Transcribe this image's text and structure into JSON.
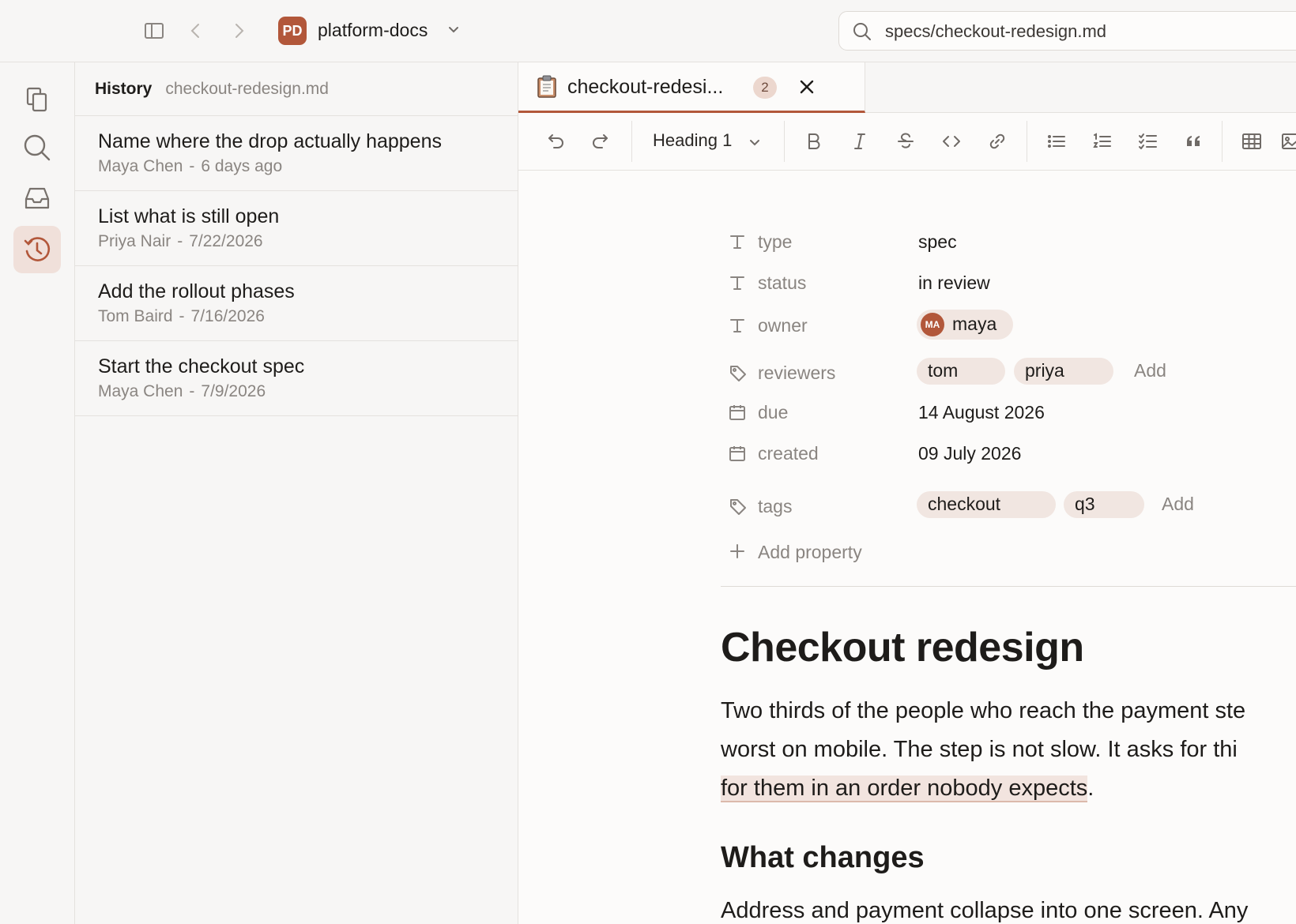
{
  "workspace": {
    "initials": "PD",
    "name": "platform-docs"
  },
  "search": {
    "value": "specs/checkout-redesign.md"
  },
  "history": {
    "title": "History",
    "file": "checkout-redesign.md",
    "commits": [
      {
        "message": "Name where the drop actually happens",
        "author": "Maya Chen",
        "date": "6 days ago"
      },
      {
        "message": "List what is still open",
        "author": "Priya Nair",
        "date": "7/22/2026"
      },
      {
        "message": "Add the rollout phases",
        "author": "Tom Baird",
        "date": "7/16/2026"
      },
      {
        "message": "Start the checkout spec",
        "author": "Maya Chen",
        "date": "7/9/2026"
      }
    ],
    "separator": "-"
  },
  "tab": {
    "label": "checkout-redesi...",
    "badge": "2"
  },
  "toolbar": {
    "block_type": "Heading 1"
  },
  "properties": {
    "type": {
      "key": "type",
      "value": "spec"
    },
    "status": {
      "key": "status",
      "value": "in review"
    },
    "owner": {
      "key": "owner",
      "initials": "MA",
      "name": "maya"
    },
    "reviewers": {
      "key": "reviewers",
      "values": [
        "tom",
        "priya"
      ],
      "add_label": "Add"
    },
    "due": {
      "key": "due",
      "value": "14 August 2026"
    },
    "created": {
      "key": "created",
      "value": "09 July 2026"
    },
    "tags": {
      "key": "tags",
      "values": [
        "checkout",
        "q3"
      ],
      "add_label": "Add"
    },
    "add_property_label": "Add property"
  },
  "document": {
    "title": "Checkout redesign",
    "para1_line1": "Two thirds of the people who reach the payment ste",
    "para1_line2": "worst on mobile. The step is not slow. It asks for thi",
    "para1_highlight": "for them in an order nobody expects",
    "para1_end": ".",
    "heading2": "What changes",
    "para2": "Address and payment collapse into one screen. Any"
  },
  "colors": {
    "accent": "#b2573a",
    "chip_bg": "#f1e6e1",
    "panel_bg": "#f7f6f5"
  }
}
